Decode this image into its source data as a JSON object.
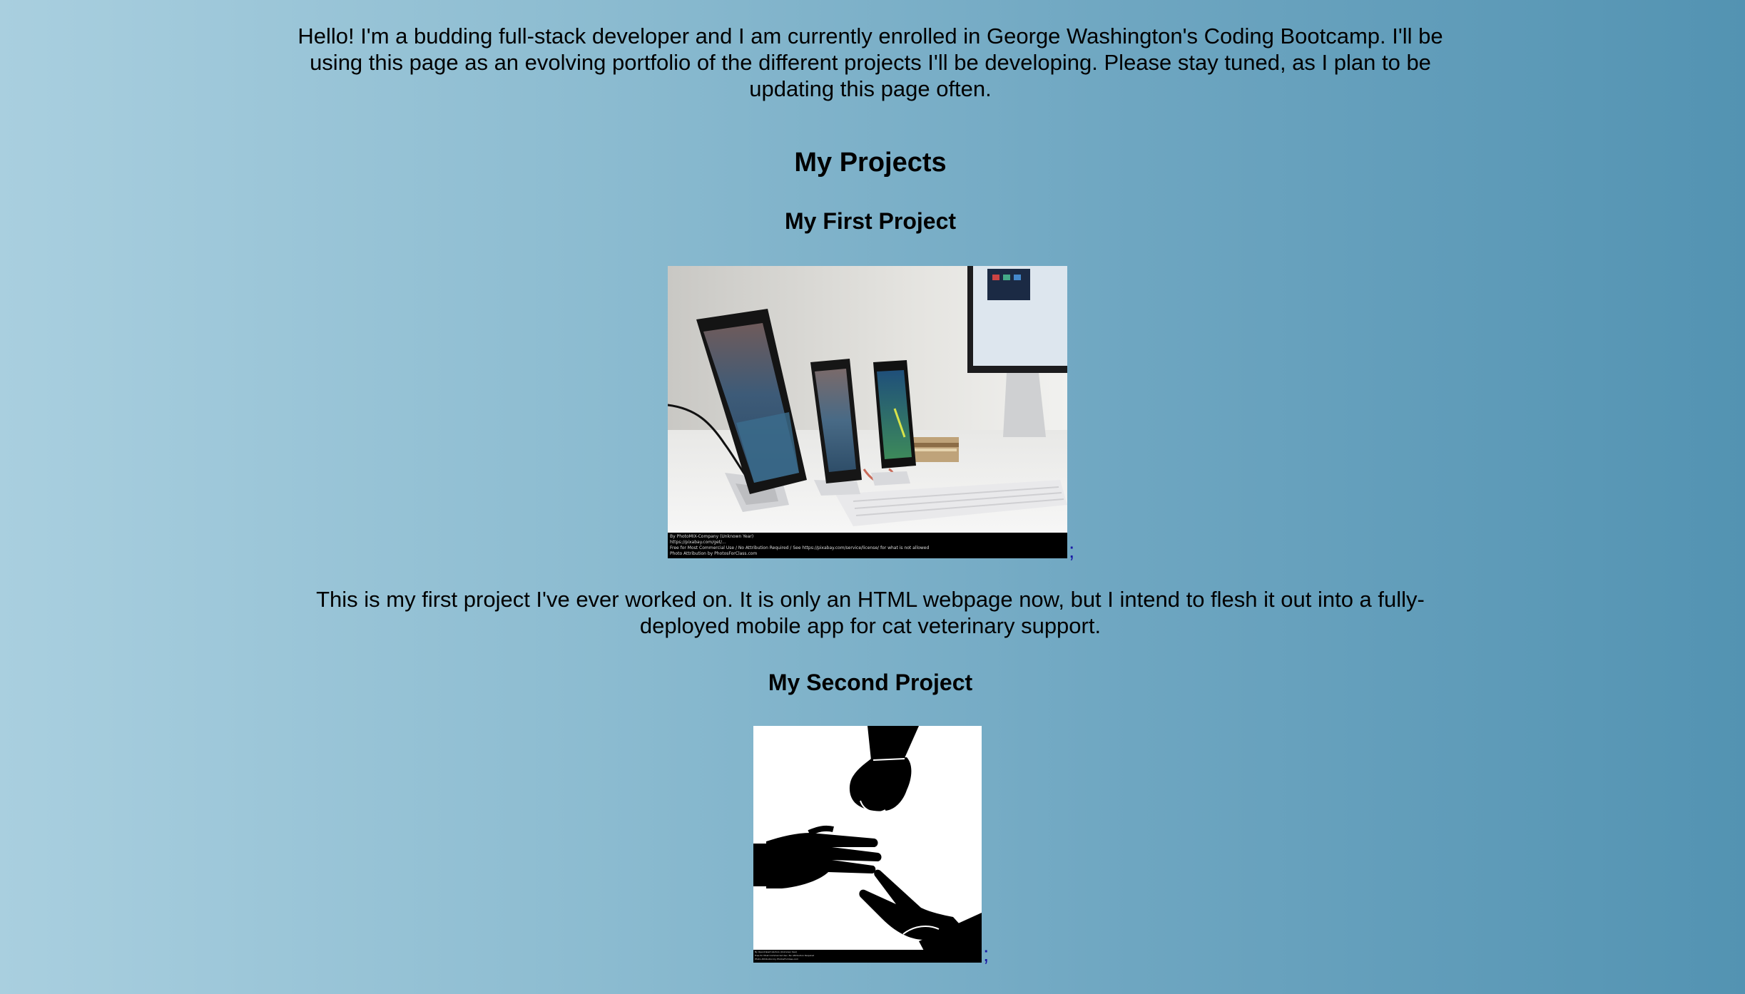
{
  "intro": {
    "text": "Hello! I'm a budding full-stack developer and I am currently enrolled in George Washington's Coding Bootcamp. I'll be using this page as an evolving portfolio of the different projects I'll be developing. Please stay tuned, as I plan to be updating this page often."
  },
  "projects_section": {
    "title": "My Projects",
    "projects": [
      {
        "title": "My First Project",
        "image_icon": "phones-on-stands-photo",
        "image_caption_lines": [
          "By PhotoMIX-Company (Unknown Year)",
          "https://pixabay.com/get/...",
          "Free for Most Commercial Use / No Attribution Required / See https://pixabay.com/service/license/ for what is not allowed",
          "Photo Attribution by PhotosForClass.com"
        ],
        "trailing_text": ";",
        "description": "This is my first project I've ever worked on. It is only an HTML webpage now, but I intend to flesh it out into a fully-deployed mobile app for cat veterinary support."
      },
      {
        "title": "My Second Project",
        "image_icon": "rock-paper-scissors-hands-photo",
        "image_caption_lines": [
          "By OpenClipart-Vectors (Unknown Year)",
          "Free for Most Commercial Use / No Attribution Required",
          "Photo Attribution by PhotosForClass.com"
        ],
        "trailing_text": ";"
      }
    ]
  },
  "colors": {
    "background_left": "#a9cfdf",
    "background_right": "#5393b2",
    "text": "#000000",
    "link": "#1a1aa6"
  }
}
